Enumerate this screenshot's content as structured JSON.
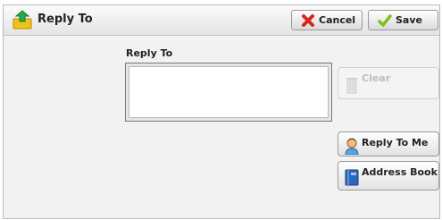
{
  "window": {
    "title": "Reply To"
  },
  "toolbar": {
    "cancel_label": "Cancel",
    "save_label": "Save"
  },
  "form": {
    "field_label": "Reply To",
    "field_value": ""
  },
  "actions": {
    "clear_label": "Clear",
    "clear_enabled": false,
    "reply_to_me_label": "Reply To Me",
    "address_book_label": "Address Book"
  },
  "icons": {
    "title": "reply-arrow-icon",
    "cancel": "x-mark-icon",
    "save": "checkmark-icon",
    "clear": "trash-can-icon",
    "reply_to_me": "person-icon",
    "address_book": "book-icon"
  },
  "colors": {
    "cancel_icon": "#d42a1e",
    "save_icon": "#7cc21a",
    "address_book_icon": "#2c67b8"
  }
}
